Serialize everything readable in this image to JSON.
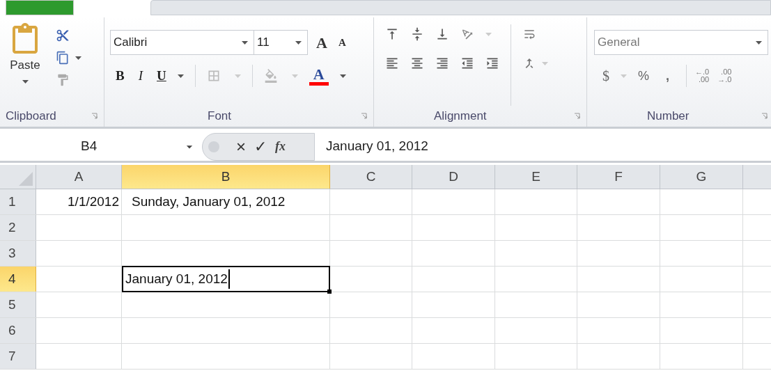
{
  "ribbon": {
    "clipboard": {
      "paste": "Paste",
      "label": "Clipboard"
    },
    "font": {
      "name": "Calibri",
      "size": "11",
      "grow": "A",
      "shrink": "A",
      "bold": "B",
      "italic": "I",
      "underline": "U",
      "color_letter": "A",
      "label": "Font"
    },
    "alignment": {
      "label": "Alignment"
    },
    "number": {
      "format": "General",
      "currency": "$",
      "percent": "%",
      "comma": ",",
      "decimals": [
        {
          "top": "←.0",
          "bottom": ".00"
        },
        {
          "top": ".00",
          "bottom": "→.0"
        }
      ],
      "label": "Number"
    }
  },
  "formula_bar": {
    "name_box": "B4",
    "cancel": "×",
    "enter": "✓",
    "function": "fx",
    "value": "January 01, 2012"
  },
  "columns": [
    {
      "label": "A",
      "selected": false
    },
    {
      "label": "B",
      "selected": true
    },
    {
      "label": "C",
      "selected": false
    },
    {
      "label": "D",
      "selected": false
    },
    {
      "label": "E",
      "selected": false
    },
    {
      "label": "F",
      "selected": false
    },
    {
      "label": "G",
      "selected": false
    }
  ],
  "rows": [
    {
      "label": "1",
      "selected": false,
      "cells": [
        {
          "kind": "number",
          "text": "1/1/2012"
        },
        {
          "kind": "text",
          "text": "Sunday, January 01, 2012"
        }
      ]
    },
    {
      "label": "2",
      "selected": false,
      "cells": []
    },
    {
      "label": "3",
      "selected": false,
      "cells": []
    },
    {
      "label": "4",
      "selected": true,
      "cells": [
        {
          "kind": "empty"
        },
        {
          "kind": "editing",
          "text": "January 01, 2012"
        }
      ]
    },
    {
      "label": "5",
      "selected": false,
      "cells": []
    },
    {
      "label": "6",
      "selected": false,
      "cells": []
    },
    {
      "label": "7",
      "selected": false,
      "cells": []
    }
  ]
}
